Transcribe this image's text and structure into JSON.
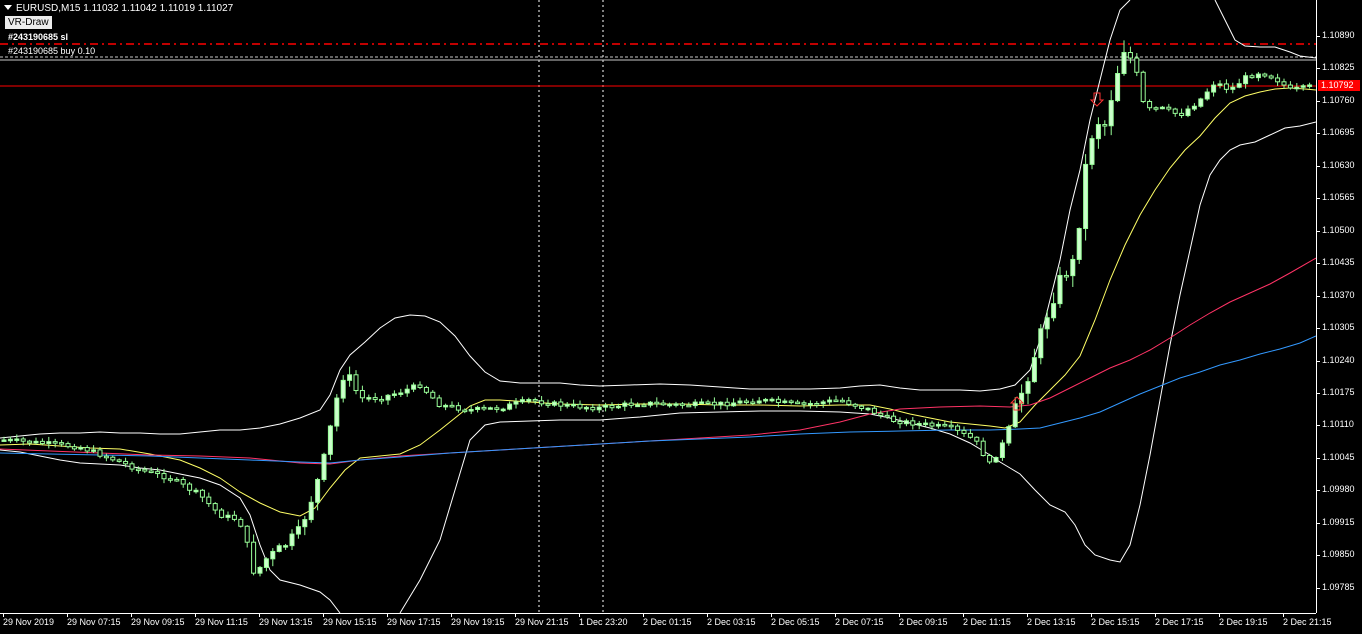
{
  "header": {
    "symbol_text": "EURUSD,M15  1.11032 1.11042 1.11019 1.11027",
    "indicator_label": "VR-Draw"
  },
  "orders": {
    "sl_label": "#243190685 sl",
    "buy_label": "#243190685 buy 0.10"
  },
  "price_axis": {
    "labels": [
      "1.10890",
      "1.10825",
      "1.10760",
      "1.10695",
      "1.10630",
      "1.10565",
      "1.10500",
      "1.10435",
      "1.10370",
      "1.10305",
      "1.10240",
      "1.10175",
      "1.10110",
      "1.10045",
      "1.09980",
      "1.09915",
      "1.09850",
      "1.09785"
    ],
    "current_price": "1.10792"
  },
  "time_axis": {
    "labels": [
      "29 Nov 2019",
      "29 Nov 07:15",
      "29 Nov 09:15",
      "29 Nov 11:15",
      "29 Nov 13:15",
      "29 Nov 15:15",
      "29 Nov 17:15",
      "29 Nov 19:15",
      "29 Nov 21:15",
      "1 Dec 23:20",
      "2 Dec 01:15",
      "2 Dec 03:15",
      "2 Dec 05:15",
      "2 Dec 07:15",
      "2 Dec 09:15",
      "2 Dec 11:15",
      "2 Dec 13:15",
      "2 Dec 15:15",
      "2 Dec 17:15",
      "2 Dec 19:15",
      "2 Dec 21:15"
    ]
  },
  "colors": {
    "background": "#000000",
    "candle_bull": "#ccffcc",
    "candle_bear": "#000000",
    "candle_outline": "#99ff99",
    "bollinger": "#ffffff",
    "ma_fast": "#ffff66",
    "ma_slow": "#ff3366",
    "ma_long": "#3399ff",
    "sl_line": "#ff0000",
    "price_line": "#ff0000"
  },
  "chart_data": {
    "type": "candlestick",
    "symbol": "EURUSD",
    "timeframe": "M15",
    "ylim": [
      1.0978,
      1.1094
    ],
    "current_price": 1.10792,
    "levels": {
      "stop_loss": 1.10872,
      "current": 1.10792
    },
    "ohlc_samples": [
      {
        "t": "29 Nov 2019",
        "o": 1.1012,
        "h": 1.1014,
        "l": 1.101,
        "c": 1.1011
      },
      {
        "t": "29 Nov 11:15",
        "o": 1.0997,
        "h": 1.0999,
        "l": 1.0981,
        "c": 1.0985
      },
      {
        "t": "29 Nov 15:15",
        "o": 1.102,
        "h": 1.1028,
        "l": 1.1016,
        "c": 1.1025
      },
      {
        "t": "29 Nov 21:15",
        "o": 1.1018,
        "h": 1.1022,
        "l": 1.1016,
        "c": 1.102
      },
      {
        "t": "2 Dec 07:15",
        "o": 1.1019,
        "h": 1.1022,
        "l": 1.1016,
        "c": 1.1018
      },
      {
        "t": "2 Dec 11:15",
        "o": 1.1006,
        "h": 1.1008,
        "l": 1.1003,
        "c": 1.1005
      },
      {
        "t": "2 Dec 13:15",
        "o": 1.104,
        "h": 1.105,
        "l": 1.1037,
        "c": 1.1045
      },
      {
        "t": "2 Dec 15:15",
        "o": 1.108,
        "h": 1.1089,
        "l": 1.1074,
        "c": 1.1085
      },
      {
        "t": "2 Dec 21:15",
        "o": 1.1079,
        "h": 1.1081,
        "l": 1.1078,
        "c": 1.1079
      }
    ]
  }
}
